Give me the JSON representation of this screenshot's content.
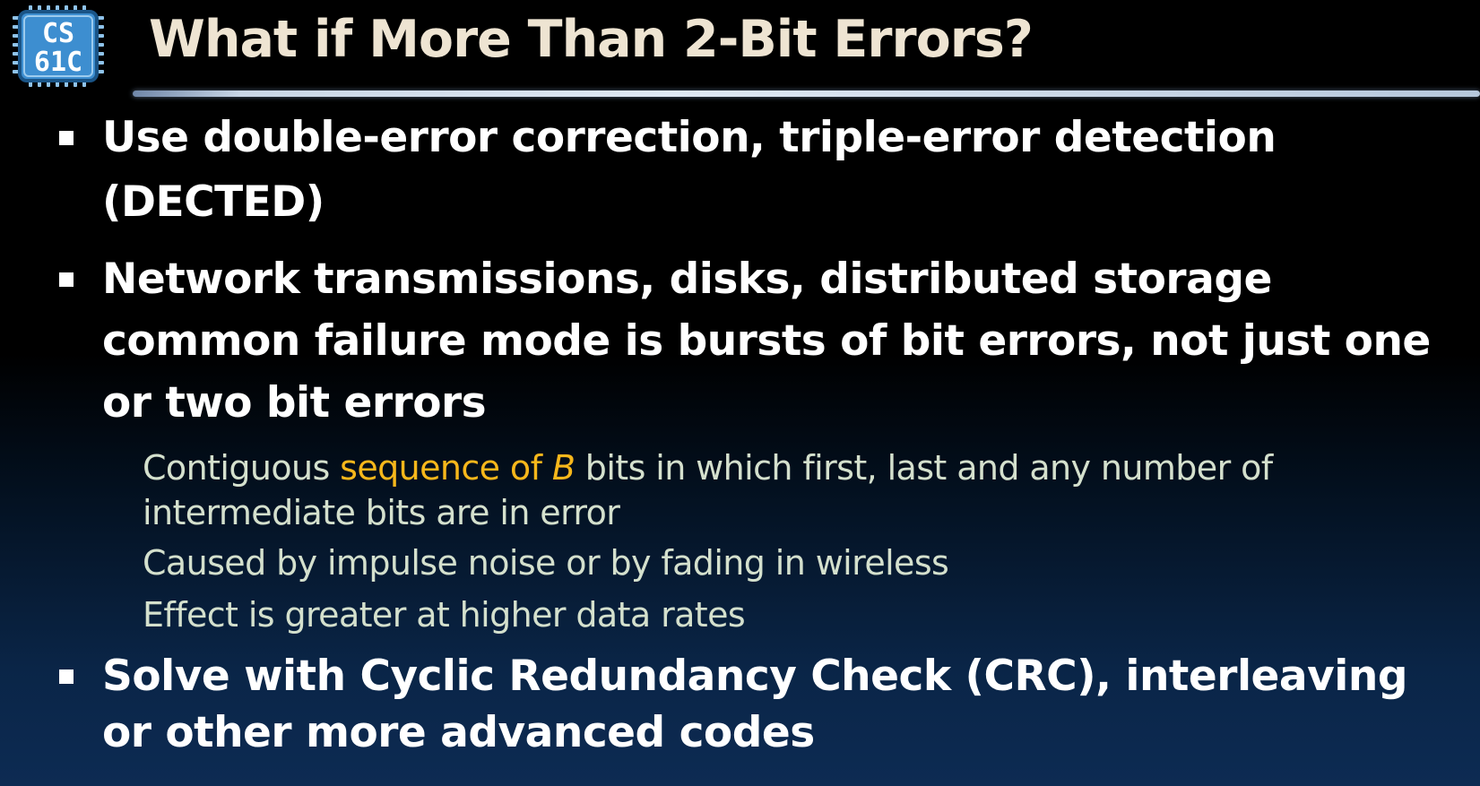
{
  "logo": {
    "line1": "CS",
    "line2": "61C"
  },
  "title": "What if More Than 2-Bit Errors?",
  "bullets": [
    {
      "text": "Use double-error correction, triple-error detection (DECTED)"
    },
    {
      "text": "Network transmissions, disks, distributed storage common failure mode is bursts of bit errors, not just one or two bit errors",
      "subs": [
        {
          "pre": "Contiguous ",
          "highlight": "sequence of ",
          "highlight_var": "B",
          "post": " bits in which first, last and any number of intermediate bits are in error"
        },
        {
          "text": "Caused by impulse noise or by fading in wireless"
        },
        {
          "text": "Effect is greater at higher data rates"
        }
      ]
    },
    {
      "text": "Solve with Cyclic Redundancy Check (CRC), interleaving or other more advanced codes"
    }
  ],
  "colors": {
    "title": "#eee4d2",
    "bullet_text": "#ffffff",
    "sub_text": "#d4e0cd",
    "highlight": "#f7b71b",
    "logo_fill": "#3d8ed0"
  }
}
